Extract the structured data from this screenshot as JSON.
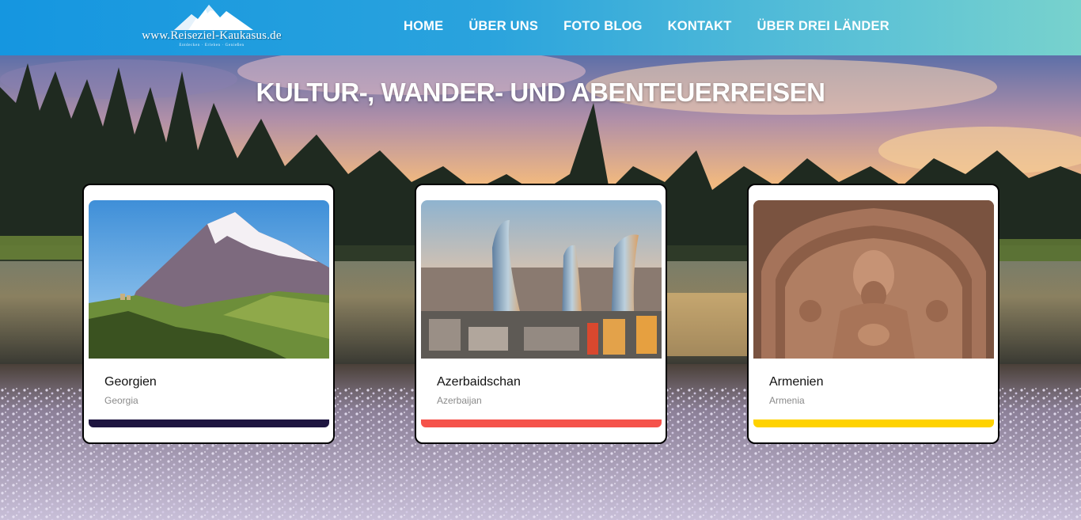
{
  "header": {
    "logo_text": "www.Reiseziel-Kaukasus.de",
    "logo_tagline": "Entdecken · Erleben · Genießen",
    "nav": [
      "HOME",
      "ÜBER UNS",
      "FOTO BLOG",
      "KONTAKT",
      "ÜBER DREI LÄNDER"
    ]
  },
  "hero": {
    "title": "KULTUR-, WANDER- UND ABENTEUERREISEN"
  },
  "cards": [
    {
      "title": "Georgien",
      "subtitle": "Georgia",
      "bar_color": "#1e1540",
      "image": "mountain-landscape"
    },
    {
      "title": "Azerbaidschan",
      "subtitle": "Azerbaijan",
      "bar_color": "#f5524a",
      "image": "flame-towers-city"
    },
    {
      "title": "Armenien",
      "subtitle": "Armenia",
      "bar_color": "#ffd200",
      "image": "stone-relief-carving"
    }
  ],
  "colors": {
    "header_start": "#1596e0",
    "header_end": "#78d2cd"
  }
}
